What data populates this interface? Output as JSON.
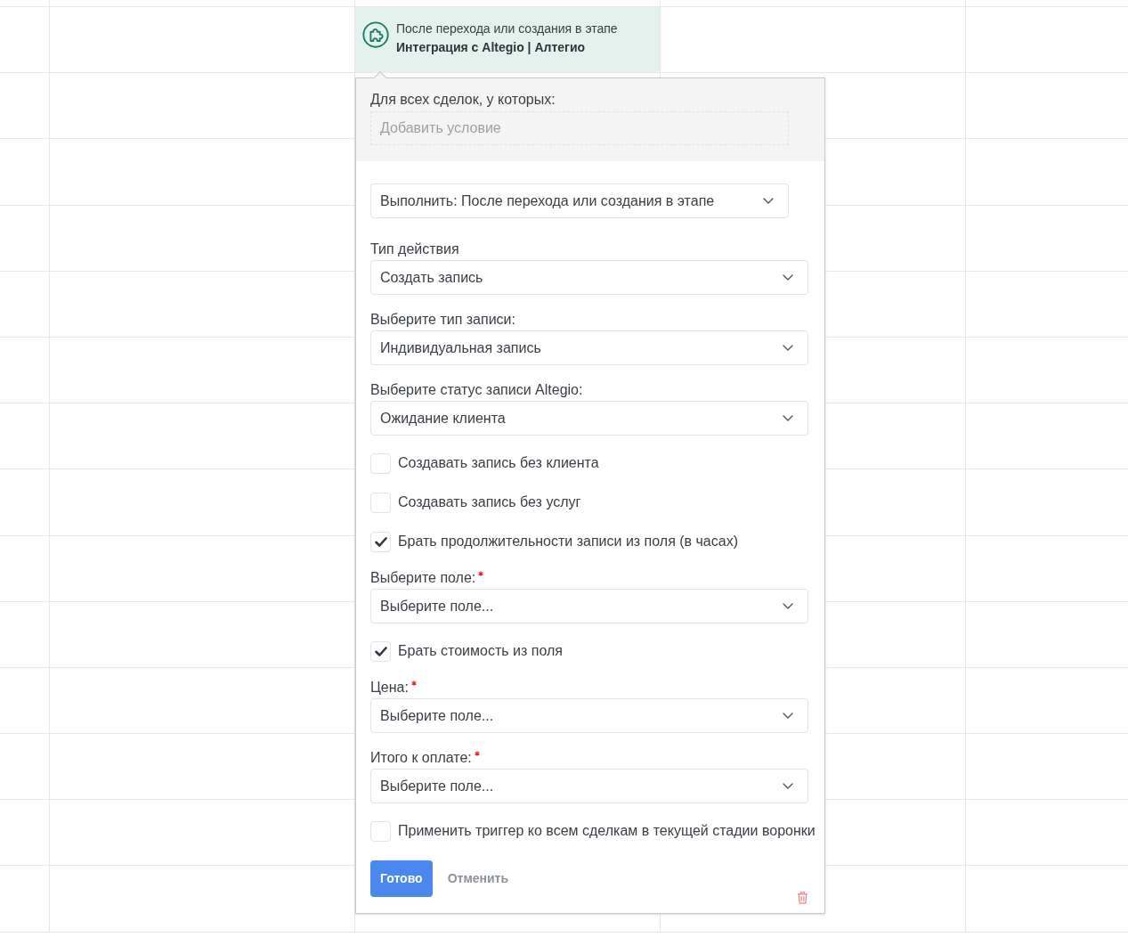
{
  "trigger_card": {
    "caption": "После перехода или создания в этапе",
    "title": "Интеграция с Altegio | Алтегио"
  },
  "popup": {
    "conditions": {
      "label": "Для всех сделок, у которых:",
      "placeholder": "Добавить условие"
    },
    "execute_select": {
      "value": "Выполнить: После перехода или создания в этапе"
    },
    "fields": [
      {
        "kind": "select",
        "label": "Тип действия",
        "required": false,
        "value": "Создать запись"
      },
      {
        "kind": "select",
        "label": "Выберите тип записи:",
        "required": false,
        "value": "Индивидуальная запись"
      },
      {
        "kind": "select",
        "label": "Выберите статус записи Altegio:",
        "required": false,
        "value": "Ожидание клиента"
      },
      {
        "kind": "checkbox",
        "label": "Создавать запись без клиента",
        "checked": false
      },
      {
        "kind": "checkbox",
        "label": "Создавать запись без услуг",
        "checked": false
      },
      {
        "kind": "checkbox",
        "label": "Брать продолжительности записи из поля (в часах)",
        "checked": true
      },
      {
        "kind": "select",
        "label": "Выберите поле:",
        "required": true,
        "value": "Выберите поле..."
      },
      {
        "kind": "checkbox",
        "label": "Брать стоимость из поля",
        "checked": true
      },
      {
        "kind": "select",
        "label": "Цена:",
        "required": true,
        "value": "Выберите поле..."
      },
      {
        "kind": "select",
        "label": "Итого к оплате:",
        "required": true,
        "value": "Выберите поле..."
      },
      {
        "kind": "checkbox",
        "label": "Применить триггер ко всем сделкам в текущей стадии воронки",
        "checked": false
      }
    ],
    "buttons": [
      {
        "kind": "primary",
        "label": "Готово"
      },
      {
        "kind": "secondary",
        "label": "Отменить"
      }
    ]
  }
}
